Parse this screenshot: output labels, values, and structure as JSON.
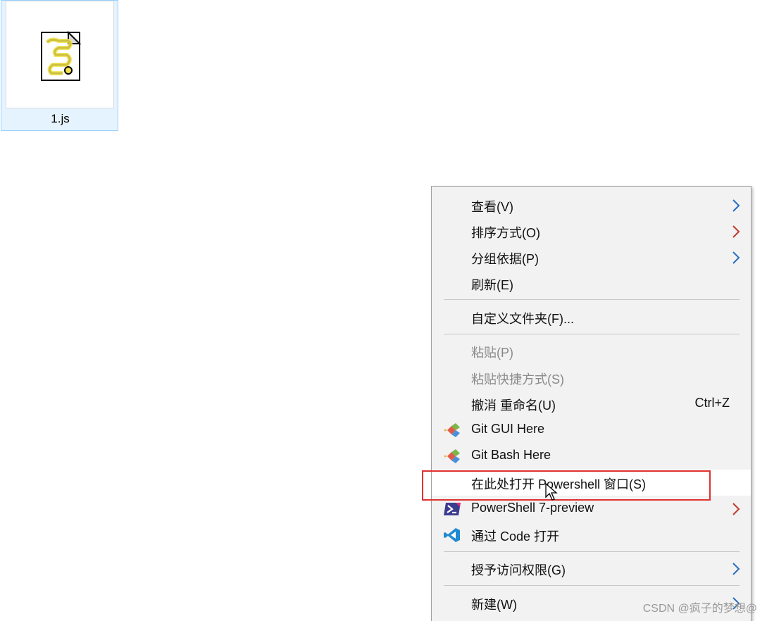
{
  "file": {
    "name": "1.js",
    "icon": "script-file-icon"
  },
  "menu": {
    "items": [
      {
        "label": "查看(V)",
        "submenu": true
      },
      {
        "label": "排序方式(O)",
        "submenu": true
      },
      {
        "label": "分组依据(P)",
        "submenu": true
      },
      {
        "label": "刷新(E)"
      },
      {
        "label": "自定义文件夹(F)..."
      },
      {
        "label": "粘贴(P)",
        "disabled": true
      },
      {
        "label": "粘贴快捷方式(S)",
        "disabled": true
      },
      {
        "label": "撤消 重命名(U)",
        "shortcut": "Ctrl+Z"
      },
      {
        "label": "Git GUI Here",
        "icon": "git-icon"
      },
      {
        "label": "Git Bash Here",
        "icon": "git-icon"
      },
      {
        "label": "在此处打开 Powershell 窗口(S)"
      },
      {
        "label": "PowerShell 7-preview",
        "icon": "powershell-icon",
        "submenu": true
      },
      {
        "label": "通过 Code 打开",
        "icon": "vscode-icon"
      },
      {
        "label": "授予访问权限(G)",
        "submenu": true
      },
      {
        "label": "新建(W)",
        "submenu": true
      }
    ]
  },
  "watermark": "CSDN @疯子的梦想@",
  "colors": {
    "highlight_box": "#e03030",
    "arrow_blue": "#2a6fc0",
    "arrow_red": "#c0392b"
  }
}
